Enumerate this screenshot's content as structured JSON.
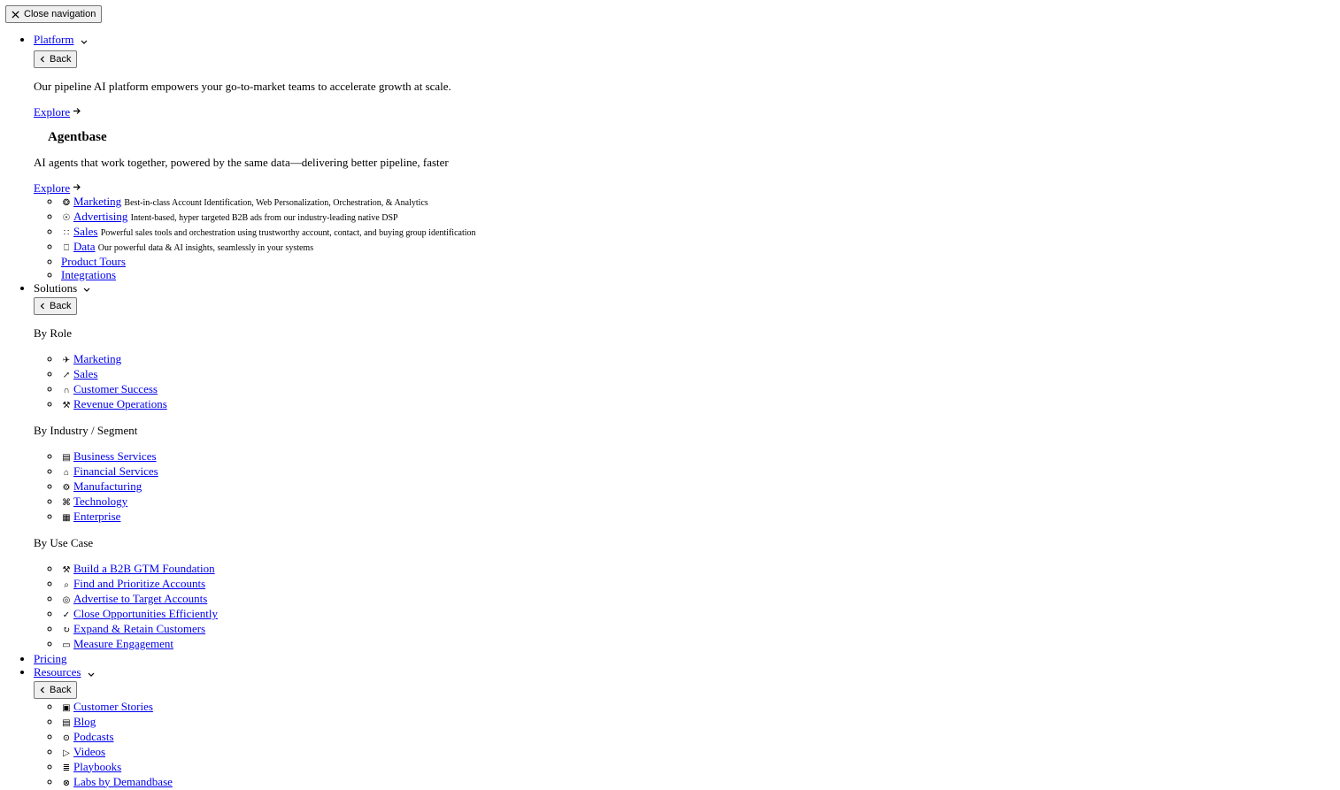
{
  "nav": {
    "close_label": "Close navigation",
    "back_label": "Back",
    "platform": {
      "label": "Platform",
      "description": "Our pipeline AI platform empowers your go-to-market teams to accelerate growth at scale.",
      "explore_label": "Explore",
      "agentbase_title": "Agentbase",
      "agentbase_description": "AI agents that work together, powered by the same data—delivering better pipeline, faster",
      "agentbase_explore_label": "Explore",
      "items": [
        {
          "label": "Marketing",
          "desc": "Best-in-class Account Identification, Web Personalization, Orchestration, & Analytics",
          "icon": "marketing-icon"
        },
        {
          "label": "Advertising",
          "desc": "Intent-based, hyper targeted B2B ads from our industry-leading native DSP",
          "icon": "advertising-icon"
        },
        {
          "label": "Sales",
          "desc": "Powerful sales tools and orchestration using trustworthy account, contact, and buying group identification",
          "icon": "sales-icon"
        },
        {
          "label": "Data",
          "desc": "Our powerful data & AI insights, seamlessly in your systems",
          "icon": "database-icon"
        },
        {
          "label": "Product Tours"
        },
        {
          "label": "Integrations"
        }
      ]
    },
    "solutions": {
      "label": "Solutions",
      "by_role_label": "By Role",
      "by_role": [
        "Marketing",
        "Sales",
        "Customer Success",
        "Revenue Operations"
      ],
      "by_industry_label": "By Industry / Segment",
      "by_industry": [
        "Business Services",
        "Financial Services",
        "Manufacturing",
        "Technology",
        "Enterprise"
      ],
      "by_use_case_label": "By Use Case",
      "by_use_case": [
        "Build a B2B GTM Foundation",
        "Find and Prioritize Accounts",
        "Advertise to Target Accounts",
        "Close Opportunities Efficiently",
        "Expand & Retain Customers",
        "Measure Engagement"
      ]
    },
    "pricing_label": "Pricing",
    "resources": {
      "label": "Resources",
      "items": [
        "Customer Stories",
        "Blog",
        "Podcasts",
        "Videos",
        "Playbooks",
        "Labs by Demandbase"
      ]
    }
  }
}
